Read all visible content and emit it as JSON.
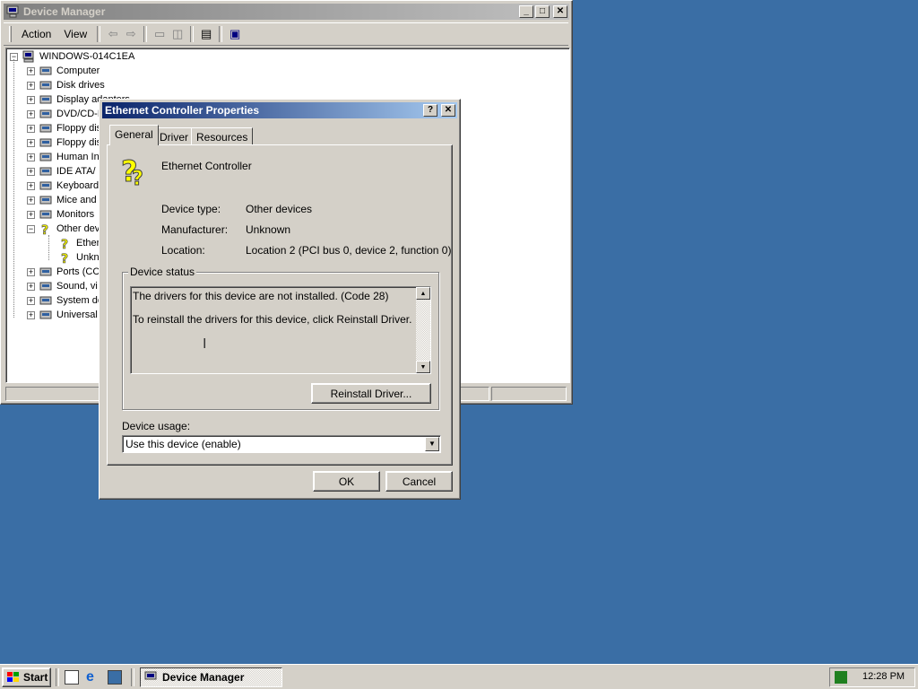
{
  "device_manager": {
    "title": "Device Manager",
    "menu": [
      "Action",
      "View"
    ],
    "computer_name": "WINDOWS-014C1EA",
    "tree": [
      {
        "label": "Computer",
        "icon": "computer-icon",
        "expanded": false
      },
      {
        "label": "Disk drives",
        "icon": "disk-drive-icon",
        "expanded": false
      },
      {
        "label": "Display adapters",
        "icon": "display-adapter-icon",
        "expanded": false
      },
      {
        "label": "DVD/CD-R",
        "icon": "cdrom-icon",
        "expanded": false
      },
      {
        "label": "Floppy dis",
        "icon": "floppy-controller-icon",
        "expanded": false
      },
      {
        "label": "Floppy dis",
        "icon": "floppy-drive-icon",
        "expanded": false
      },
      {
        "label": "Human In",
        "icon": "hid-icon",
        "expanded": false
      },
      {
        "label": "IDE ATA/",
        "icon": "ide-icon",
        "expanded": false
      },
      {
        "label": "Keyboard",
        "icon": "keyboard-icon",
        "expanded": false
      },
      {
        "label": "Mice and",
        "icon": "mouse-icon",
        "expanded": false
      },
      {
        "label": "Monitors",
        "icon": "monitor-icon",
        "expanded": false
      },
      {
        "label": "Other dev",
        "icon": "unknown-device-icon",
        "expanded": true,
        "children": [
          {
            "label": "Ether",
            "icon": "unknown-device-icon"
          },
          {
            "label": "Unkno",
            "icon": "unknown-device-icon"
          }
        ]
      },
      {
        "label": "Ports (CC",
        "icon": "port-icon",
        "expanded": false
      },
      {
        "label": "Sound, vi",
        "icon": "sound-icon",
        "expanded": false
      },
      {
        "label": "System de",
        "icon": "system-device-icon",
        "expanded": false
      },
      {
        "label": "Universal",
        "icon": "usb-icon",
        "expanded": false
      }
    ]
  },
  "dialog": {
    "title": "Ethernet Controller Properties",
    "tabs": [
      "General",
      "Driver",
      "Resources"
    ],
    "active_tab": "General",
    "device_name": "Ethernet Controller",
    "device_type_label": "Device type:",
    "device_type": "Other devices",
    "manufacturer_label": "Manufacturer:",
    "manufacturer": "Unknown",
    "location_label": "Location:",
    "location": "Location 2 (PCI bus 0, device 2, function 0)",
    "status_group": "Device status",
    "status_line1": "The drivers for this device are not installed. (Code 28)",
    "status_line2": "To reinstall the drivers for this device, click Reinstall Driver.",
    "reinstall_button": "Reinstall Driver...",
    "usage_label": "Device usage:",
    "usage_value": "Use this device (enable)",
    "ok_button": "OK",
    "cancel_button": "Cancel"
  },
  "taskbar": {
    "start_label": "Start",
    "task_label": "Device Manager",
    "clock": "12:28 PM"
  },
  "colors": {
    "desktop": "#3a6ea5",
    "active_title": "#0a246a",
    "inactive_title": "#808080",
    "face": "#d4d0c8"
  }
}
